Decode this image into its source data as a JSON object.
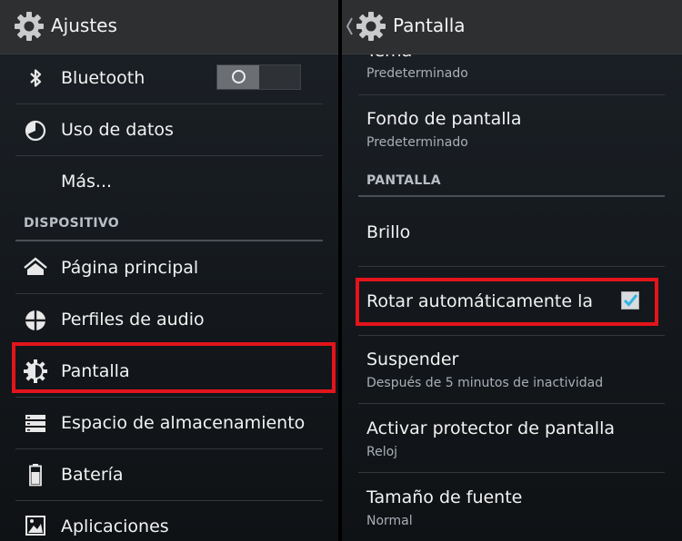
{
  "left_panel": {
    "title": "Ajustes",
    "items": [
      {
        "label": "Bluetooth",
        "icon": "bluetooth-icon"
      },
      {
        "label": "Uso de datos",
        "icon": "data-usage-icon"
      },
      {
        "label": "Más...",
        "icon": ""
      },
      {
        "label": "Página principal",
        "icon": "home-icon"
      },
      {
        "label": "Perfiles de audio",
        "icon": "audio-profiles-icon"
      },
      {
        "label": "Pantalla",
        "icon": "display-icon"
      },
      {
        "label": "Espacio de almacenamiento",
        "icon": "storage-icon"
      },
      {
        "label": "Batería",
        "icon": "battery-icon"
      },
      {
        "label": "Aplicaciones",
        "icon": "apps-icon"
      }
    ],
    "section_device": "DISPOSITIVO",
    "bluetooth_toggle": "off"
  },
  "right_panel": {
    "title": "Pantalla",
    "items": [
      {
        "title": "Tema",
        "subtitle": "Predeterminado"
      },
      {
        "title": "Fondo de pantalla",
        "subtitle": "Predeterminado"
      },
      {
        "title": "Brillo",
        "subtitle": ""
      },
      {
        "title": "Rotar automáticamente la",
        "subtitle": "",
        "checked": true
      },
      {
        "title": "Suspender",
        "subtitle": "Después de 5 minutos de inactividad"
      },
      {
        "title": "Activar protector de pantalla",
        "subtitle": "Reloj"
      },
      {
        "title": "Tamaño de fuente",
        "subtitle": "Normal"
      }
    ],
    "section_display": "PANTALLA"
  },
  "colors": {
    "highlight": "#e3141b",
    "accent": "#33b5e5"
  }
}
